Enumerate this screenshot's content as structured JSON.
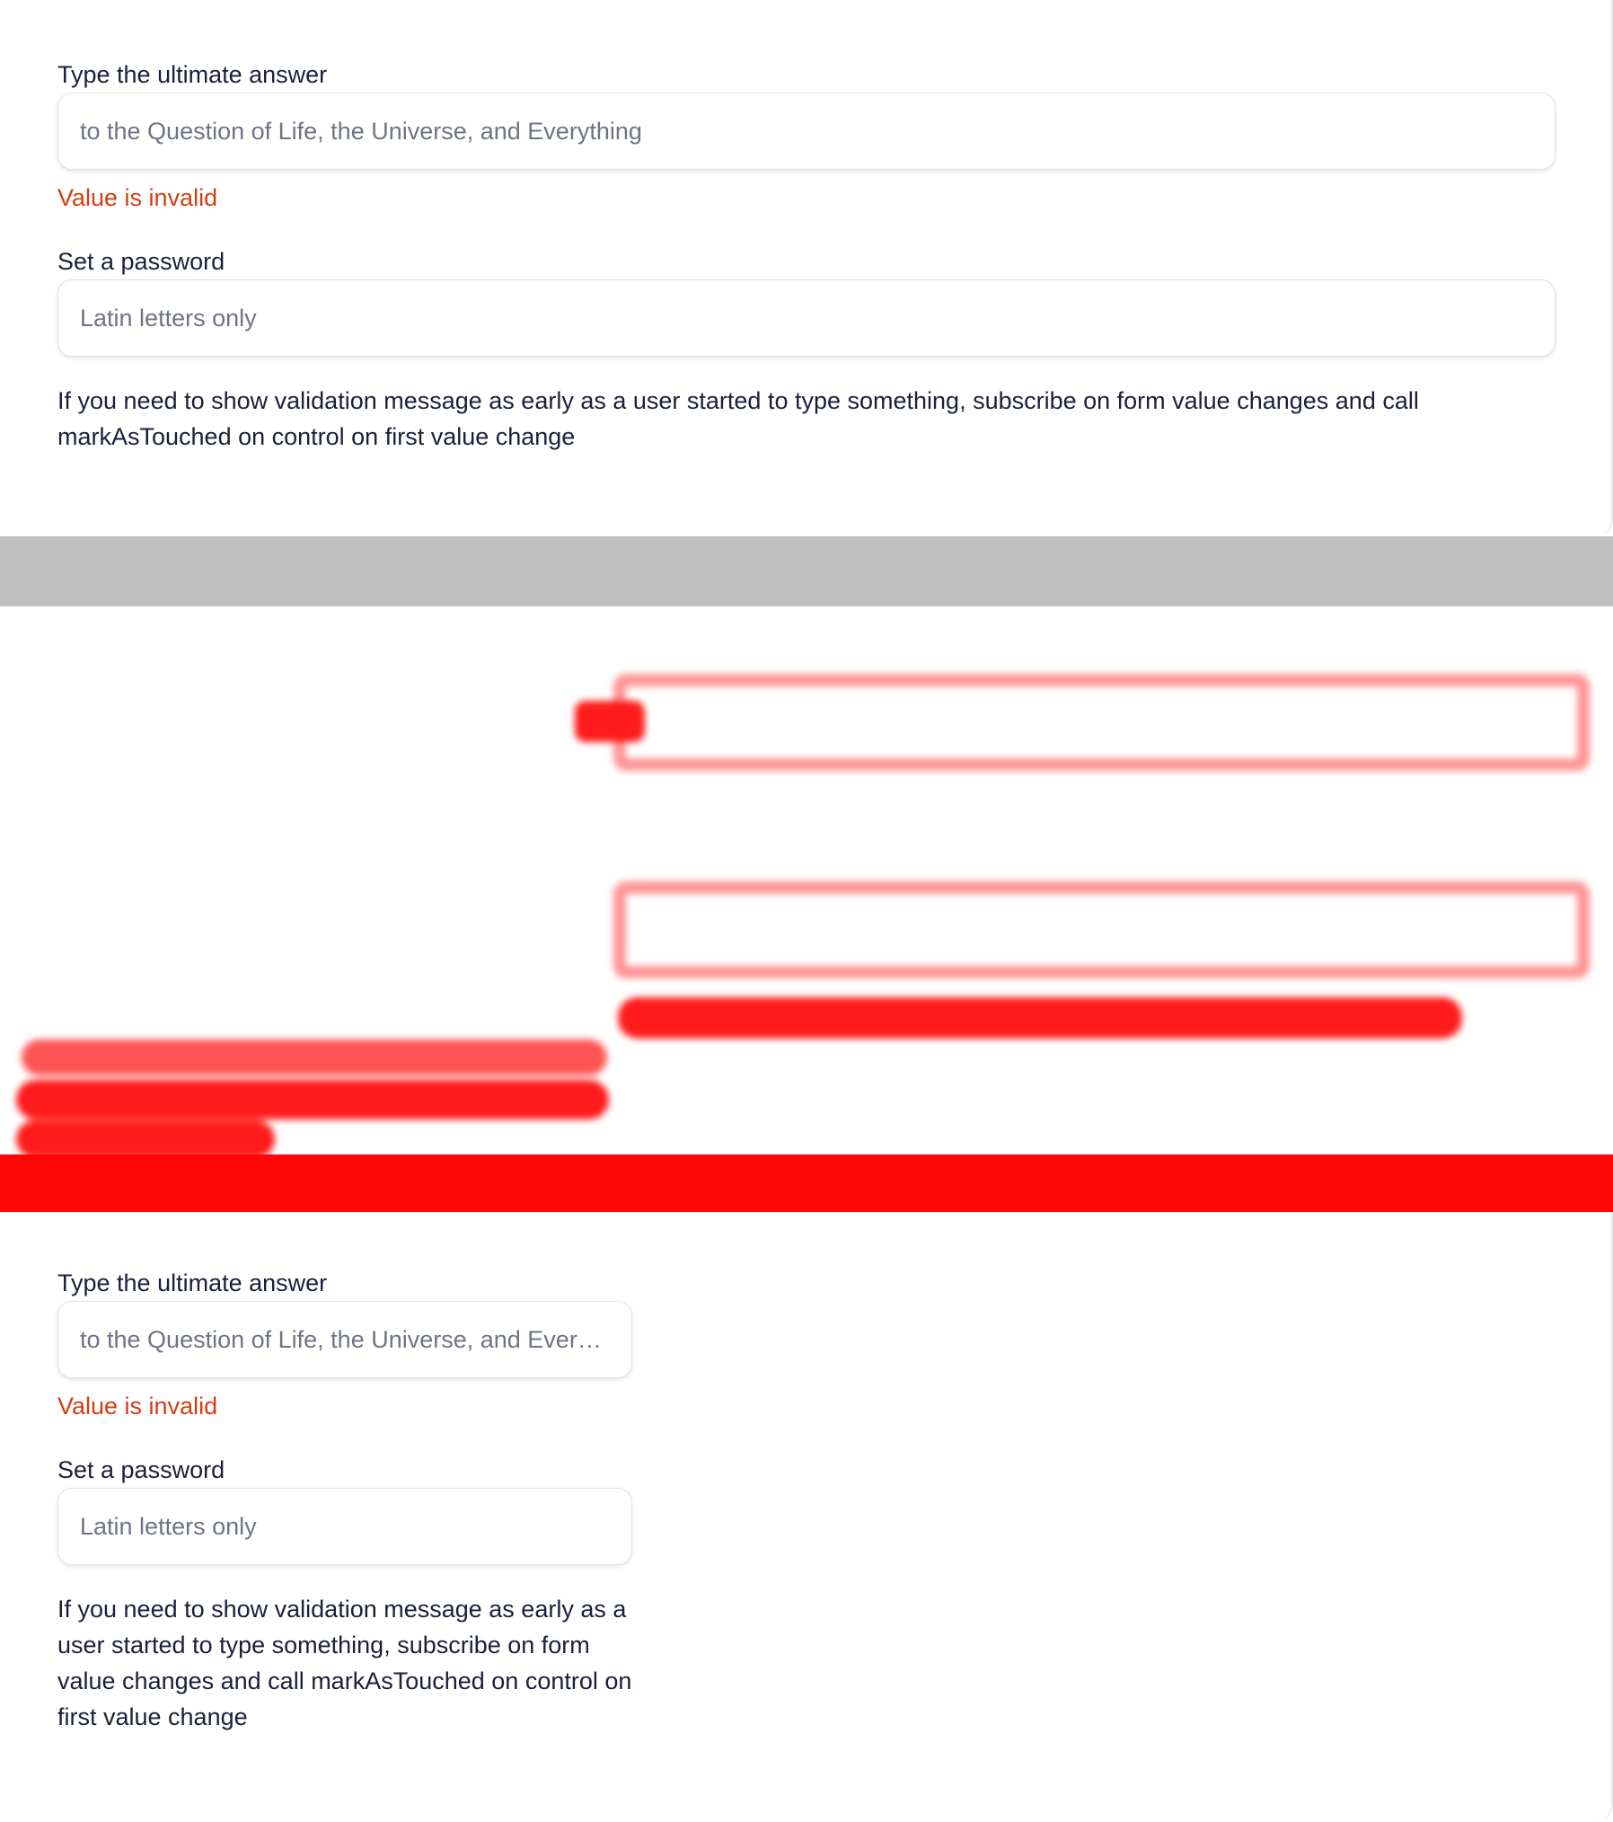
{
  "wide_form": {
    "answer_label": "Type the ultimate answer",
    "answer_placeholder": "to the Question of Life, the Universe, and Everything",
    "error": "Value is invalid",
    "password_label": "Set a password",
    "password_placeholder": "Latin letters only",
    "hint": "If you need to show validation message as early as a user started to type something, subscribe on form value changes and call markAsTouched on control on first value change"
  },
  "narrow_form": {
    "answer_label": "Type the ultimate answer",
    "answer_placeholder": "to the Question of Life, the Universe, and Everything",
    "error": "Value is invalid",
    "password_label": "Set a password",
    "password_placeholder": "Latin letters only",
    "hint": "If you need to show validation message as early as a user started to type something, subscribe on form value changes and call markAsTouched on control on first value change"
  },
  "colors": {
    "text": "#1b1f3b",
    "placeholder": "#6f7484",
    "error": "#d43d12",
    "separator": "#bfbfbf",
    "diff": "#ff0000"
  }
}
